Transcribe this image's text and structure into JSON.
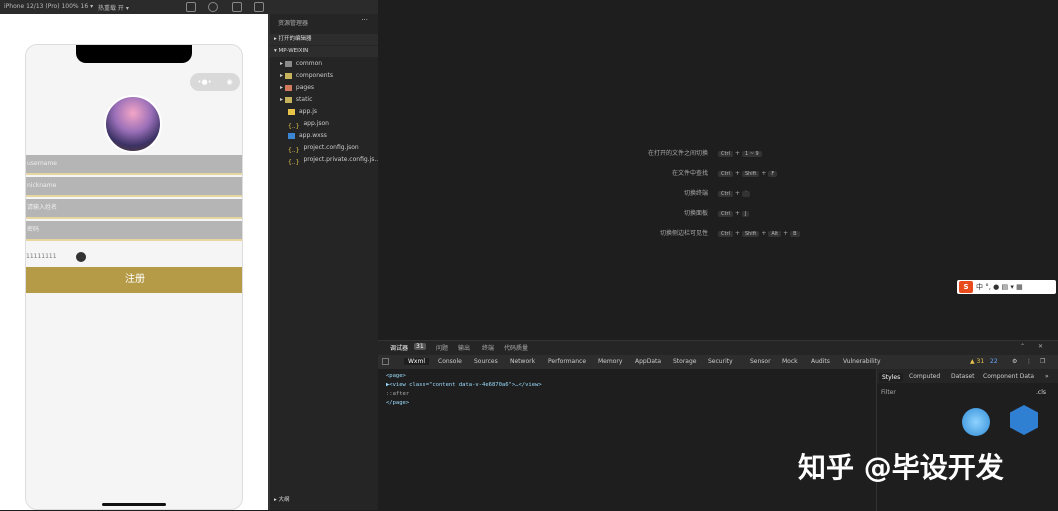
{
  "topbar": {
    "device": "iPhone 12/13 (Pro) 100% 16 ▾",
    "hot_reload": "热重载 开 ▾"
  },
  "phone": {
    "fields": [
      " username",
      " nickname",
      "请输入姓名",
      " 密码"
    ],
    "password_row_text": "11111111",
    "register_button": "注册"
  },
  "explorer": {
    "title": "资源管理器",
    "more": "···",
    "sections": {
      "open_editors": "▸ 打开的编辑器",
      "project": "▾ MP-WEIXIN",
      "outline": "▸ 大纲"
    },
    "items": [
      {
        "label": "common",
        "type": "folder"
      },
      {
        "label": "components",
        "type": "folder"
      },
      {
        "label": "pages",
        "type": "folder"
      },
      {
        "label": "static",
        "type": "folder"
      },
      {
        "label": "app.js",
        "type": "js"
      },
      {
        "label": "app.json",
        "type": "json"
      },
      {
        "label": "app.wxss",
        "type": "wxss"
      },
      {
        "label": "project.config.json",
        "type": "json"
      },
      {
        "label": "project.private.config.js...",
        "type": "json"
      }
    ]
  },
  "editor": {
    "hints": [
      {
        "label": "在打开的文件之间切换",
        "keys": [
          "Ctrl",
          "+",
          "1 ~ 9"
        ]
      },
      {
        "label": "在文件中查找",
        "keys": [
          "Ctrl",
          "+",
          "Shift",
          "+",
          "F"
        ]
      },
      {
        "label": "切换终端",
        "keys": [
          "Ctrl",
          "+",
          "`"
        ]
      },
      {
        "label": "切换面板",
        "keys": [
          "Ctrl",
          "+",
          "J"
        ]
      },
      {
        "label": "切换侧边栏可见性",
        "keys": [
          "Ctrl",
          "+",
          "Shift",
          "+",
          "Alt",
          "+",
          "B"
        ]
      }
    ]
  },
  "ime": {
    "logo": "S",
    "text": "中 °, ● ▤ ▾ ▦"
  },
  "devtools": {
    "top_tabs": [
      "调试器",
      "31",
      "问题",
      "输出",
      "终端",
      "代码质量"
    ],
    "tabs": [
      "Wxml",
      "Console",
      "Sources",
      "Network",
      "Performance",
      "Memory",
      "AppData",
      "Storage",
      "Security",
      "Sensor",
      "Mock",
      "Audits",
      "Vulnerability"
    ],
    "warnings": "▲ 31",
    "errors": "22",
    "code_lines": [
      "<page>",
      "▶<view class=\"content data-v-4e6870a6\">…</view>",
      "  ::after",
      "</page>"
    ],
    "styles_tabs": [
      "Styles",
      "Computed",
      "Dataset",
      "Component Data",
      "»"
    ],
    "filter": "Filter",
    "cls": ".cls"
  },
  "watermark": "知乎 @毕设开发"
}
